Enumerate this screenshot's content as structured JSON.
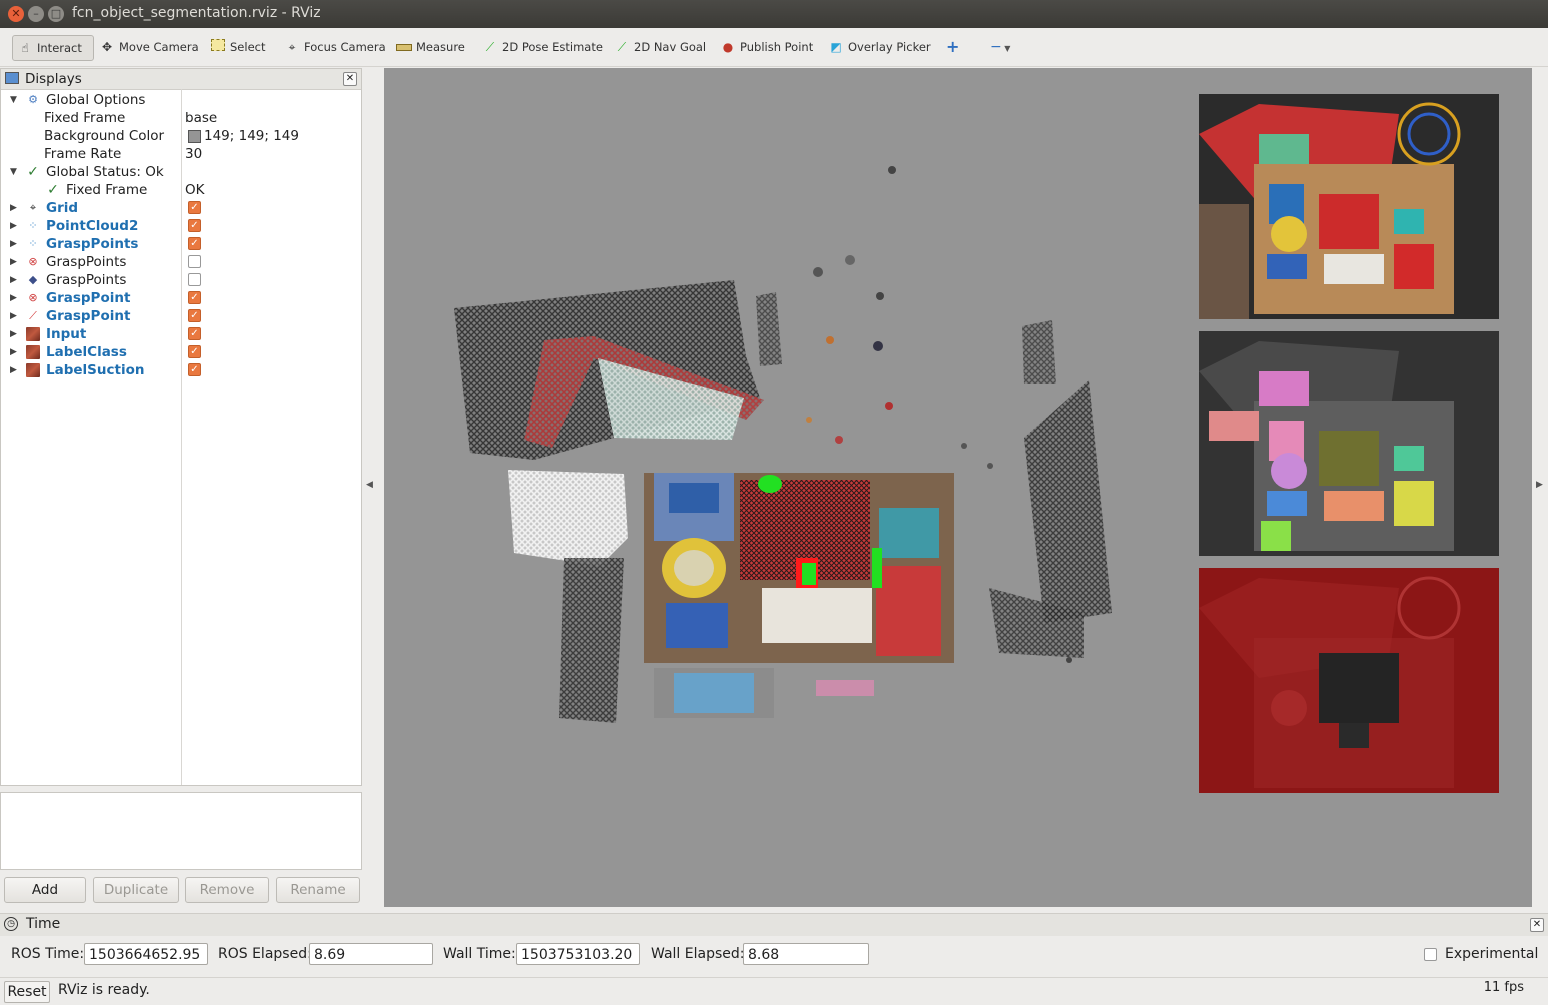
{
  "window": {
    "title": "fcn_object_segmentation.rviz - RViz"
  },
  "toolbar": {
    "interact": "Interact",
    "move_camera": "Move Camera",
    "select": "Select",
    "focus_camera": "Focus Camera",
    "measure": "Measure",
    "pose_estimate": "2D Pose Estimate",
    "nav_goal": "2D Nav Goal",
    "publish_point": "Publish Point",
    "overlay_picker": "Overlay Picker"
  },
  "displays": {
    "title": "Displays",
    "global_options": "Global Options",
    "fixed_frame_label": "Fixed Frame",
    "fixed_frame_value": "base",
    "background_color_label": "Background Color",
    "background_color_value": "149; 149; 149",
    "background_color_hex": "#959595",
    "frame_rate_label": "Frame Rate",
    "frame_rate_value": "30",
    "global_status": "Global Status: Ok",
    "status_fixed_frame": "Fixed Frame",
    "status_fixed_frame_value": "OK",
    "items": [
      {
        "label": "Grid",
        "checked": true,
        "icon": "grid-icon"
      },
      {
        "label": "PointCloud2",
        "checked": true,
        "icon": "pointcloud-icon"
      },
      {
        "label": "GraspPoints",
        "checked": true,
        "icon": "pointcloud-icon"
      },
      {
        "label": "GraspPoints",
        "checked": false,
        "icon": "marker-icon"
      },
      {
        "label": "GraspPoints",
        "checked": false,
        "icon": "diamond-icon"
      },
      {
        "label": "GraspPoint",
        "checked": true,
        "icon": "marker-icon"
      },
      {
        "label": "GraspPoint",
        "checked": true,
        "icon": "pose-arrow-icon"
      },
      {
        "label": "Input",
        "checked": true,
        "icon": "image-icon"
      },
      {
        "label": "LabelClass",
        "checked": true,
        "icon": "image-icon"
      },
      {
        "label": "LabelSuction",
        "checked": true,
        "icon": "image-icon"
      }
    ],
    "buttons": {
      "add": "Add",
      "duplicate": "Duplicate",
      "remove": "Remove",
      "rename": "Rename"
    }
  },
  "time": {
    "title": "Time",
    "ros_time_label": "ROS Time:",
    "ros_time": "1503664652.95",
    "ros_elapsed_label": "ROS Elapsed:",
    "ros_elapsed": "8.69",
    "wall_time_label": "Wall Time:",
    "wall_time": "1503753103.20",
    "wall_elapsed_label": "Wall Elapsed:",
    "wall_elapsed": "8.68",
    "experimental": "Experimental"
  },
  "status": {
    "reset": "Reset",
    "message": "RViz is ready.",
    "fps": "11 fps"
  }
}
